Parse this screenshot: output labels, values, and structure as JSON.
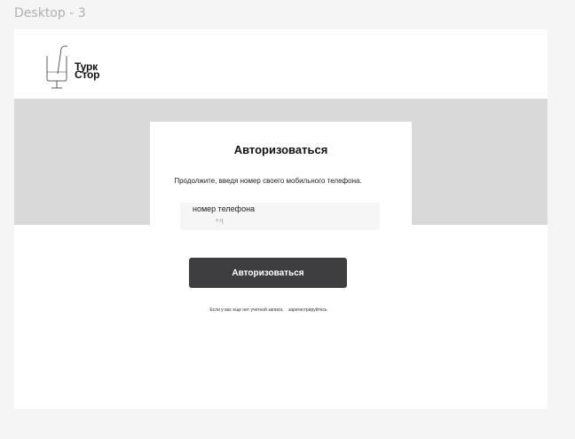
{
  "canvas": {
    "frame_label": "Desktop - 3"
  },
  "logo": {
    "line1": "Турк",
    "line2": "Стор",
    "icon": "glass-with-straw-icon"
  },
  "auth": {
    "title": "Авторизоваться",
    "subtitle": "Продолжите, введя номер своего мобильного телефона.",
    "phone_label": "номер телефона",
    "phone_placeholder": "+7(",
    "button_label": "Авторизоваться",
    "register_prompt": "Если у вас еще нет учетной записи,",
    "register_link": "зарегистрируйтесь"
  },
  "colors": {
    "band": "#d9d9d9",
    "button": "#3e3e40",
    "input_bg": "#f6f6f6"
  }
}
